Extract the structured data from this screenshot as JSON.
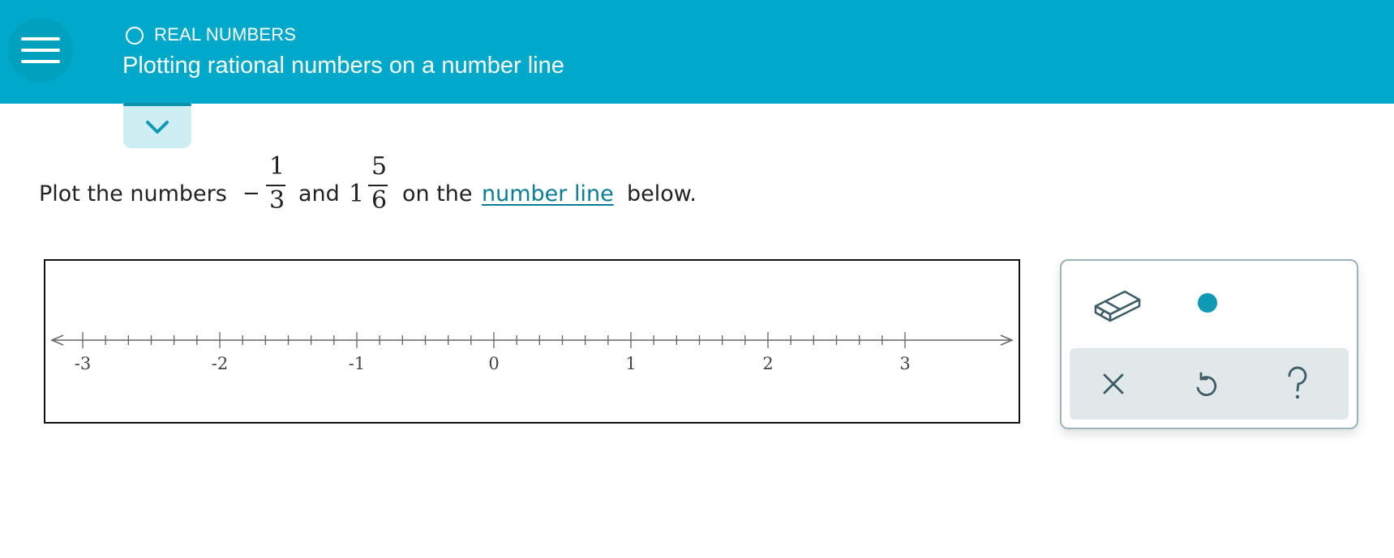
{
  "header": {
    "topic": "REAL NUMBERS",
    "title": "Plotting rational numbers on a number line"
  },
  "question": {
    "prefix": "Plot the numbers",
    "frac1": {
      "sign": "−",
      "numerator": "1",
      "denominator": "3"
    },
    "middle": "and",
    "frac2": {
      "whole": "1",
      "numerator": "5",
      "denominator": "6"
    },
    "before_link": "on the",
    "link": "number line",
    "suffix": "below."
  },
  "number_line": {
    "min": -3,
    "max": 3,
    "minor_step": 0.1666667,
    "labels": [
      "-3",
      "-2",
      "-1",
      "0",
      "1",
      "2",
      "3"
    ]
  },
  "colors": {
    "header": "#00a9c9",
    "accent": "#0e9ab5",
    "link": "#0a7d96",
    "tool_icon": "#3d5c66"
  },
  "icons": {
    "menu": "hamburger-icon",
    "topic": "circle-outline-icon",
    "expand": "chevron-down-icon",
    "eraser": "eraser-icon",
    "point": "point-dot-icon",
    "clear": "x-icon",
    "undo": "undo-icon",
    "help": "question-mark-icon"
  }
}
